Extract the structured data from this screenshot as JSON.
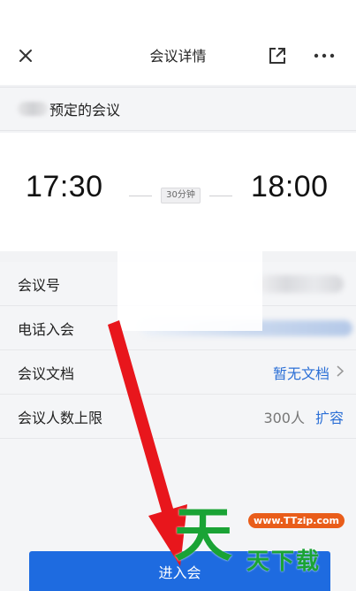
{
  "header": {
    "title": "会议详情",
    "close_icon": "close-icon",
    "share_icon": "share-external-icon",
    "more_icon": "more-dots-icon"
  },
  "organizer": {
    "suffix": "预定的会议"
  },
  "schedule": {
    "start_time": "17:30",
    "end_time": "18:00",
    "duration": "30分钟"
  },
  "details": {
    "meeting_id_label": "会议号",
    "phone_join_label": "电话入会",
    "docs_label": "会议文档",
    "docs_value": "暂无文档",
    "limit_label": "会议人数上限",
    "limit_value": "300人",
    "expand_label": "扩容"
  },
  "actions": {
    "join_label": "进入会"
  },
  "watermark": {
    "big_char": "天",
    "url": "www.TTzip.com",
    "text": "天下载"
  },
  "colors": {
    "accent": "#1e6be0",
    "link": "#2b6fd6",
    "annotation_arrow": "#e8161c",
    "watermark_green": "#1aa335"
  }
}
